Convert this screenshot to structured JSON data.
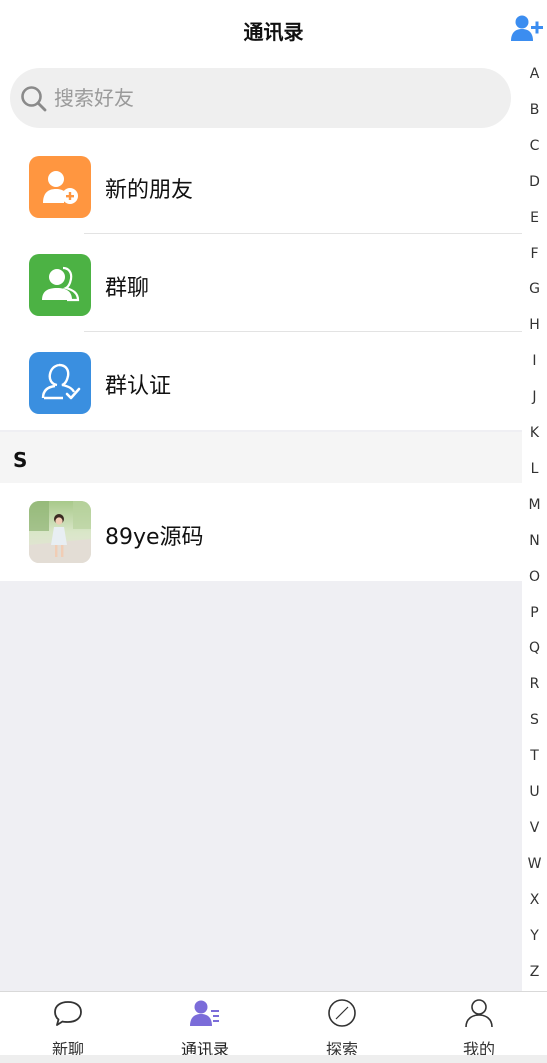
{
  "header": {
    "title": "通讯录",
    "add_icon": "add-friend-icon",
    "accent": "#3b8df0"
  },
  "search": {
    "placeholder": "搜索好友"
  },
  "menu": [
    {
      "label": "新的朋友",
      "icon": "new-friend-icon",
      "color": "#ff9640"
    },
    {
      "label": "群聊",
      "icon": "group-chat-icon",
      "color": "#4cb244"
    },
    {
      "label": "群认证",
      "icon": "group-verify-icon",
      "color": "#3a8fe0"
    }
  ],
  "section": {
    "letter": "S"
  },
  "contacts": [
    {
      "name": "89ye源码",
      "avatar": "photo-avatar"
    }
  ],
  "index_letters": [
    "A",
    "B",
    "C",
    "D",
    "E",
    "F",
    "G",
    "H",
    "I",
    "J",
    "K",
    "L",
    "M",
    "N",
    "O",
    "P",
    "Q",
    "R",
    "S",
    "T",
    "U",
    "V",
    "W",
    "X",
    "Y",
    "Z"
  ],
  "tabs": [
    {
      "label": "新聊",
      "icon": "chat-bubble-icon",
      "active": false
    },
    {
      "label": "通讯录",
      "icon": "contacts-icon",
      "active": true
    },
    {
      "label": "探索",
      "icon": "compass-icon",
      "active": false
    },
    {
      "label": "我的",
      "icon": "profile-icon",
      "active": false
    }
  ],
  "colors": {
    "active_tab": "#7b6cd9"
  }
}
